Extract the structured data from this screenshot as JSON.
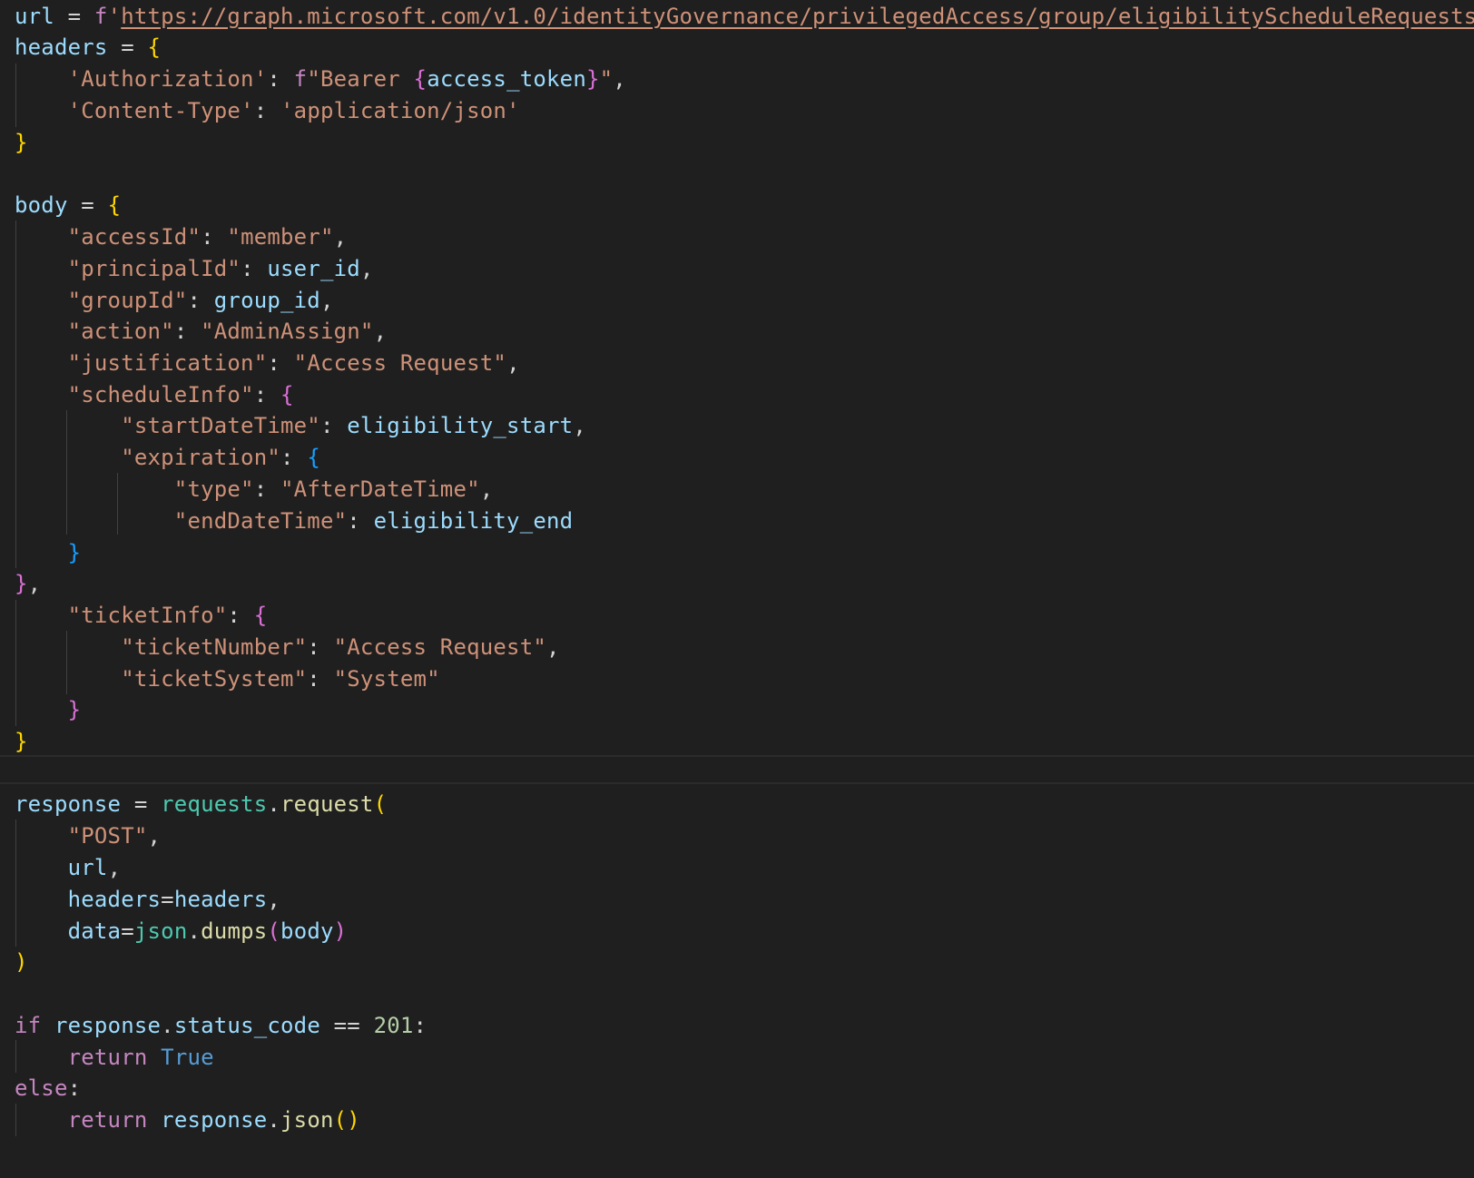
{
  "editor": {
    "language": "python",
    "colors": {
      "background": "#1f1f1f",
      "variable": "#9cdcfe",
      "string": "#ce9178",
      "keyword_purple": "#c586c0",
      "keyword_blue": "#569cd6",
      "function": "#dcdcaa",
      "module": "#4ec9b0",
      "number": "#b5cea8",
      "bracket_gold": "#ffd700",
      "bracket_purple": "#da70d6",
      "bracket_blue": "#179fff",
      "operator": "#d4d4d4"
    },
    "lines": [
      [
        [
          "url",
          "var"
        ],
        [
          " = ",
          "op"
        ],
        [
          "f",
          "kw"
        ],
        [
          "'",
          "str"
        ],
        [
          "https://graph.microsoft.com/v1.0/identityGovernance/privilegedAccess/group/eligibilityScheduleRequests",
          "url"
        ],
        [
          "'",
          "str"
        ]
      ],
      [
        [
          "headers",
          "var"
        ],
        [
          " = ",
          "op"
        ],
        [
          "{",
          "b1"
        ]
      ],
      [
        [
          "    ",
          "ws"
        ],
        [
          "'Authorization'",
          "str"
        ],
        [
          ": ",
          "op"
        ],
        [
          "f",
          "kw"
        ],
        [
          "\"Bearer ",
          "str"
        ],
        [
          "{",
          "b2"
        ],
        [
          "access_token",
          "var"
        ],
        [
          "}",
          "b2"
        ],
        [
          "\"",
          "str"
        ],
        [
          ",",
          "op"
        ]
      ],
      [
        [
          "    ",
          "ws"
        ],
        [
          "'Content-Type'",
          "str"
        ],
        [
          ": ",
          "op"
        ],
        [
          "'application/json'",
          "str"
        ]
      ],
      [
        [
          "}",
          "b1"
        ]
      ],
      [],
      [
        [
          "body",
          "var"
        ],
        [
          " = ",
          "op"
        ],
        [
          "{",
          "b1"
        ]
      ],
      [
        [
          "    ",
          "ws"
        ],
        [
          "\"accessId\"",
          "str"
        ],
        [
          ": ",
          "op"
        ],
        [
          "\"member\"",
          "str"
        ],
        [
          ",",
          "op"
        ]
      ],
      [
        [
          "    ",
          "ws"
        ],
        [
          "\"principalId\"",
          "str"
        ],
        [
          ": ",
          "op"
        ],
        [
          "user_id",
          "var"
        ],
        [
          ",",
          "op"
        ]
      ],
      [
        [
          "    ",
          "ws"
        ],
        [
          "\"groupId\"",
          "str"
        ],
        [
          ": ",
          "op"
        ],
        [
          "group_id",
          "var"
        ],
        [
          ",",
          "op"
        ]
      ],
      [
        [
          "    ",
          "ws"
        ],
        [
          "\"action\"",
          "str"
        ],
        [
          ": ",
          "op"
        ],
        [
          "\"AdminAssign\"",
          "str"
        ],
        [
          ",",
          "op"
        ]
      ],
      [
        [
          "    ",
          "ws"
        ],
        [
          "\"justification\"",
          "str"
        ],
        [
          ": ",
          "op"
        ],
        [
          "\"Access Request\"",
          "str"
        ],
        [
          ",",
          "op"
        ]
      ],
      [
        [
          "    ",
          "ws"
        ],
        [
          "\"scheduleInfo\"",
          "str"
        ],
        [
          ": ",
          "op"
        ],
        [
          "{",
          "b2"
        ]
      ],
      [
        [
          "        ",
          "ws"
        ],
        [
          "\"startDateTime\"",
          "str"
        ],
        [
          ": ",
          "op"
        ],
        [
          "eligibility_start",
          "var"
        ],
        [
          ",",
          "op"
        ]
      ],
      [
        [
          "        ",
          "ws"
        ],
        [
          "\"expiration\"",
          "str"
        ],
        [
          ": ",
          "op"
        ],
        [
          "{",
          "b3"
        ]
      ],
      [
        [
          "            ",
          "ws"
        ],
        [
          "\"type\"",
          "str"
        ],
        [
          ": ",
          "op"
        ],
        [
          "\"AfterDateTime\"",
          "str"
        ],
        [
          ",",
          "op"
        ]
      ],
      [
        [
          "            ",
          "ws"
        ],
        [
          "\"endDateTime\"",
          "str"
        ],
        [
          ": ",
          "op"
        ],
        [
          "eligibility_end",
          "var"
        ]
      ],
      [
        [
          "    ",
          "ws"
        ],
        [
          "}",
          "b3"
        ]
      ],
      [
        [
          "}",
          "b2"
        ],
        [
          ",",
          "op"
        ]
      ],
      [
        [
          "    ",
          "ws"
        ],
        [
          "\"ticketInfo\"",
          "str"
        ],
        [
          ": ",
          "op"
        ],
        [
          "{",
          "b2"
        ]
      ],
      [
        [
          "        ",
          "ws"
        ],
        [
          "\"ticketNumber\"",
          "str"
        ],
        [
          ": ",
          "op"
        ],
        [
          "\"Access Request\"",
          "str"
        ],
        [
          ",",
          "op"
        ]
      ],
      [
        [
          "        ",
          "ws"
        ],
        [
          "\"ticketSystem\"",
          "str"
        ],
        [
          ": ",
          "op"
        ],
        [
          "\"System\"",
          "str"
        ]
      ],
      [
        [
          "    ",
          "ws"
        ],
        [
          "}",
          "b2"
        ]
      ],
      [
        [
          "}",
          "b1"
        ]
      ],
      [],
      [
        [
          "response",
          "var"
        ],
        [
          " = ",
          "op"
        ],
        [
          "requests",
          "mod"
        ],
        [
          ".",
          "op"
        ],
        [
          "request",
          "fn"
        ],
        [
          "(",
          "b1"
        ]
      ],
      [
        [
          "    ",
          "ws"
        ],
        [
          "\"POST\"",
          "str"
        ],
        [
          ",",
          "op"
        ]
      ],
      [
        [
          "    ",
          "ws"
        ],
        [
          "url",
          "var"
        ],
        [
          ",",
          "op"
        ]
      ],
      [
        [
          "    ",
          "ws"
        ],
        [
          "headers",
          "var"
        ],
        [
          "=",
          "op"
        ],
        [
          "headers",
          "var"
        ],
        [
          ",",
          "op"
        ]
      ],
      [
        [
          "    ",
          "ws"
        ],
        [
          "data",
          "var"
        ],
        [
          "=",
          "op"
        ],
        [
          "json",
          "mod"
        ],
        [
          ".",
          "op"
        ],
        [
          "dumps",
          "fn"
        ],
        [
          "(",
          "b2"
        ],
        [
          "body",
          "var"
        ],
        [
          ")",
          "b2"
        ]
      ],
      [
        [
          ")",
          "b1"
        ]
      ],
      [],
      [
        [
          "if",
          "kw"
        ],
        [
          " ",
          "ws"
        ],
        [
          "response",
          "var"
        ],
        [
          ".",
          "op"
        ],
        [
          "status_code",
          "var"
        ],
        [
          " == ",
          "op"
        ],
        [
          "201",
          "num"
        ],
        [
          ":",
          "op"
        ]
      ],
      [
        [
          "    ",
          "ws"
        ],
        [
          "return",
          "kw"
        ],
        [
          " ",
          "ws"
        ],
        [
          "True",
          "kwb"
        ]
      ],
      [
        [
          "else",
          "kw"
        ],
        [
          ":",
          "op"
        ]
      ],
      [
        [
          "    ",
          "ws"
        ],
        [
          "return",
          "kw"
        ],
        [
          " ",
          "ws"
        ],
        [
          "response",
          "var"
        ],
        [
          ".",
          "op"
        ],
        [
          "json",
          "fn"
        ],
        [
          "()",
          "b1"
        ]
      ]
    ]
  }
}
